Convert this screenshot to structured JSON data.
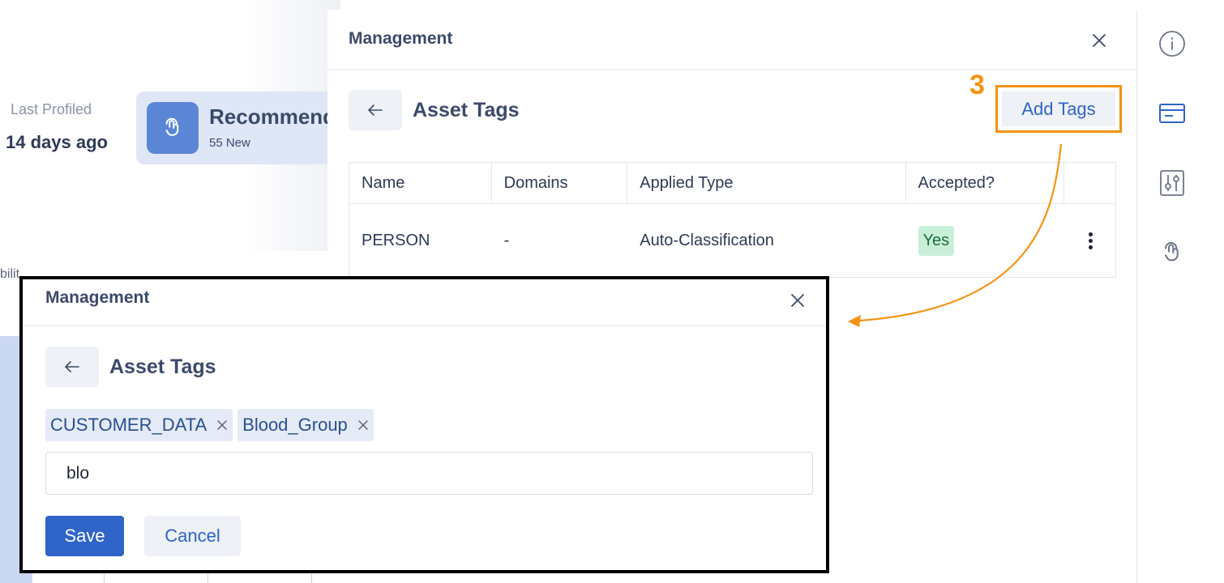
{
  "background": {
    "last_profiled_label": "Last Profiled",
    "last_profiled_value": "14 days ago",
    "recommendations_title": "Recommendations",
    "recommendations_sub": "55 New",
    "chart_label_fragment": "bilit"
  },
  "panel": {
    "title": "Management",
    "section_title": "Asset Tags",
    "step_number": "3",
    "add_tags_label": "Add Tags",
    "table": {
      "headers": [
        "Name",
        "Domains",
        "Applied Type",
        "Accepted?"
      ],
      "rows": [
        {
          "name": "PERSON",
          "domains": "-",
          "applied_type": "Auto-Classification",
          "accepted": "Yes"
        }
      ]
    }
  },
  "inset": {
    "title": "Management",
    "section_title": "Asset Tags",
    "chips": [
      "CUSTOMER_DATA",
      "Blood_Group"
    ],
    "input_value": "blo",
    "save_label": "Save",
    "cancel_label": "Cancel"
  },
  "sidebar": {
    "icons": [
      "info-icon",
      "card-icon",
      "sliders-icon",
      "touch-icon"
    ]
  },
  "colors": {
    "accent": "#2f64c8",
    "highlight": "#f39313",
    "badge_green": "#c9efd8",
    "title_text": "#3b4a6b"
  }
}
